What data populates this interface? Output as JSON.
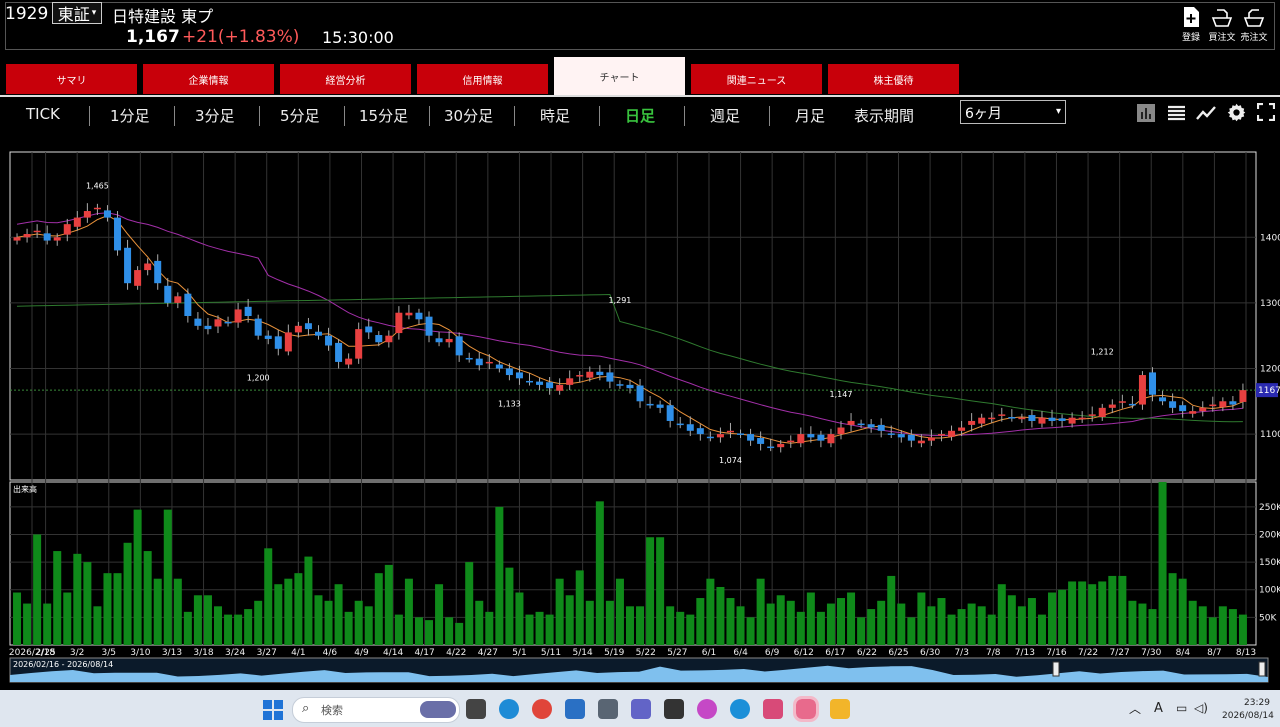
{
  "header": {
    "code": "1929",
    "market": "東証",
    "company": "日特建設  東プ",
    "price": "1,167",
    "change": "+21(+1.83%)",
    "time": "15:30:00",
    "buttons": [
      {
        "label": "登録",
        "icon": "add-document-icon"
      },
      {
        "label": "買注文",
        "icon": "buy-order-icon"
      },
      {
        "label": "売注文",
        "icon": "sell-order-icon"
      }
    ]
  },
  "tabs": [
    "サマリ",
    "企業情報",
    "経営分析",
    "信用情報",
    "チャート",
    "関連ニュース",
    "株主優待"
  ],
  "active_tab": "チャート",
  "timeframes": [
    "TICK",
    "1分足",
    "3分足",
    "5分足",
    "15分足",
    "30分足",
    "時足",
    "日足",
    "週足",
    "月足",
    "表示期間"
  ],
  "active_timeframe": "日足",
  "period_select": "6ヶ月",
  "chart_data": [
    {
      "type": "candlestick",
      "title": "",
      "y_ticks": [
        1100,
        1200,
        1300,
        1400
      ],
      "ylim": [
        1030,
        1530
      ],
      "last_price_label": "1167",
      "last_price": 1167,
      "x_ticks": [
        "2026/2/18",
        "2/25",
        "3/2",
        "3/5",
        "3/10",
        "3/13",
        "3/18",
        "3/24",
        "3/27",
        "4/1",
        "4/6",
        "4/9",
        "4/14",
        "4/17",
        "4/22",
        "4/27",
        "5/1",
        "5/11",
        "5/14",
        "5/19",
        "5/22",
        "5/27",
        "6/1",
        "6/4",
        "6/9",
        "6/12",
        "6/17",
        "6/22",
        "6/25",
        "6/30",
        "7/3",
        "7/8",
        "7/13",
        "7/16",
        "7/22",
        "7/27",
        "7/30",
        "8/4",
        "8/7",
        "8/13"
      ],
      "annotations": [
        {
          "label": "1,465",
          "value": 1465
        },
        {
          "label": "1,291",
          "value": 1291
        },
        {
          "label": "1,200",
          "value": 1200
        },
        {
          "label": "1,133",
          "value": 1133
        },
        {
          "label": "1,074",
          "value": 1074
        },
        {
          "label": "1,147",
          "value": 1147
        },
        {
          "label": "1,212",
          "value": 1212
        }
      ],
      "close": [
        1400,
        1405,
        1410,
        1395,
        1400,
        1420,
        1430,
        1440,
        1445,
        1430,
        1380,
        1330,
        1350,
        1360,
        1330,
        1300,
        1310,
        1280,
        1265,
        1260,
        1275,
        1270,
        1290,
        1280,
        1250,
        1245,
        1230,
        1255,
        1265,
        1260,
        1250,
        1235,
        1210,
        1215,
        1260,
        1255,
        1240,
        1250,
        1285,
        1285,
        1275,
        1250,
        1240,
        1245,
        1220,
        1215,
        1205,
        1210,
        1200,
        1190,
        1185,
        1180,
        1175,
        1170,
        1175,
        1185,
        1190,
        1195,
        1190,
        1180,
        1175,
        1170,
        1150,
        1145,
        1140,
        1120,
        1115,
        1105,
        1100,
        1095,
        1100,
        1105,
        1100,
        1090,
        1085,
        1080,
        1085,
        1090,
        1100,
        1095,
        1090,
        1100,
        1110,
        1120,
        1115,
        1110,
        1105,
        1100,
        1095,
        1090,
        1090,
        1095,
        1100,
        1105,
        1110,
        1120,
        1125,
        1125,
        1130,
        1125,
        1125,
        1120,
        1125,
        1120,
        1120,
        1125,
        1125,
        1130,
        1140,
        1145,
        1150,
        1145,
        1190,
        1160,
        1150,
        1140,
        1135,
        1135,
        1140,
        1145,
        1150,
        1145,
        1167
      ],
      "ma_short_label": "",
      "ma_mid_label": "",
      "ma_long_label": ""
    },
    {
      "type": "bar",
      "title": "出来高",
      "y_ticks": [
        "50K",
        "100K",
        "150K",
        "200K",
        "250K"
      ],
      "ylim": [
        0,
        295
      ],
      "values": [
        95,
        75,
        200,
        75,
        170,
        95,
        165,
        150,
        70,
        130,
        130,
        185,
        245,
        170,
        120,
        245,
        120,
        60,
        90,
        90,
        70,
        55,
        55,
        65,
        80,
        175,
        110,
        120,
        130,
        160,
        90,
        80,
        110,
        60,
        80,
        70,
        130,
        145,
        55,
        120,
        50,
        45,
        110,
        50,
        40,
        150,
        80,
        60,
        250,
        140,
        95,
        55,
        60,
        55,
        120,
        90,
        135,
        80,
        260,
        80,
        120,
        70,
        70,
        195,
        195,
        70,
        60,
        55,
        85,
        120,
        105,
        85,
        70,
        50,
        120,
        75,
        90,
        80,
        60,
        95,
        60,
        75,
        85,
        95,
        50,
        65,
        80,
        125,
        75,
        50,
        95,
        70,
        85,
        55,
        65,
        75,
        70,
        55,
        110,
        90,
        70,
        85,
        55,
        95,
        100,
        115,
        115,
        110,
        115,
        125,
        125,
        80,
        75,
        65,
        295,
        130,
        120,
        80,
        70,
        50,
        70,
        65,
        55,
        95,
        70,
        70,
        75
      ]
    }
  ],
  "navigator": {
    "range_label": "2026/02/16 - 2026/08/14"
  },
  "taskbar": {
    "search": "検索",
    "clock_time": "23:29",
    "clock_date": "2026/08/14",
    "lang": "A"
  },
  "colors": {
    "up": "#e84040",
    "down": "#2f8fe8",
    "volume": "#0f8a1a",
    "ma_short": "#e8913a",
    "ma_mid": "#a22fa8",
    "ma_long": "#2f7a2f",
    "tab": "#c8000a",
    "active_timeframe": "#39c33e",
    "change": "#ff5a5a"
  }
}
